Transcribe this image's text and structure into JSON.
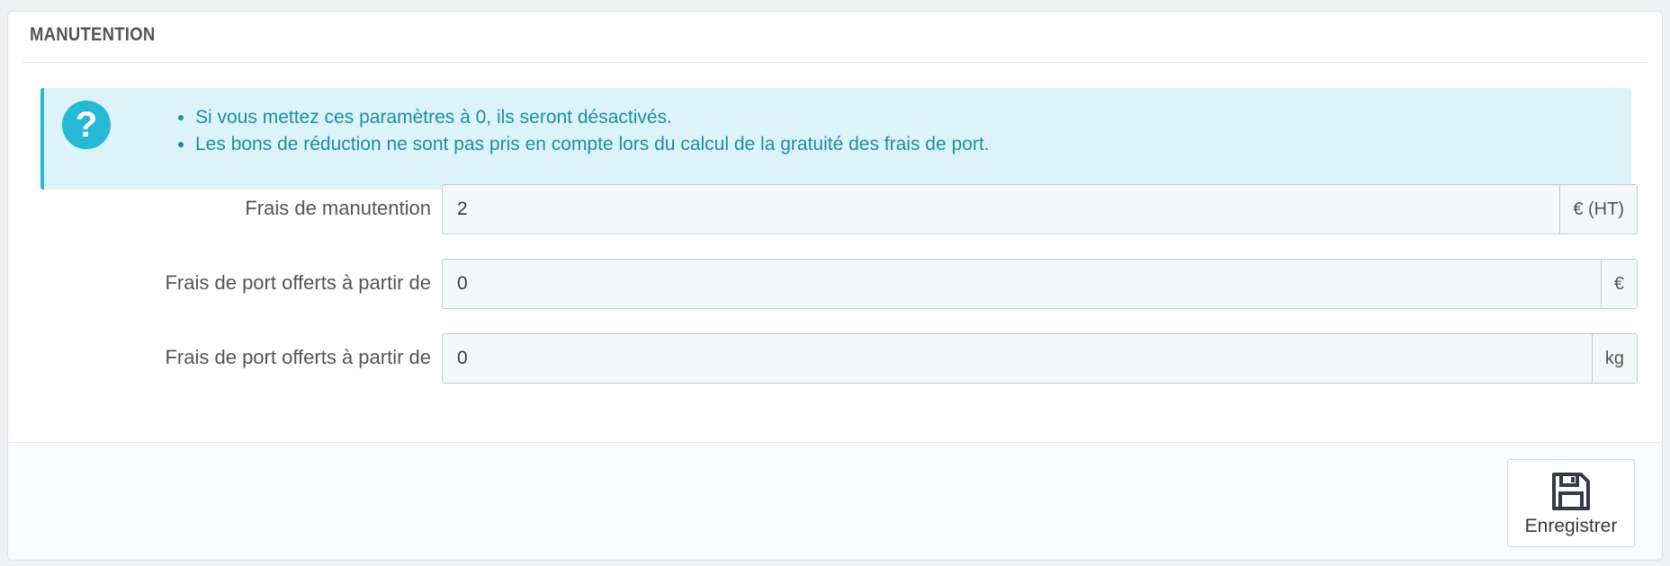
{
  "panel": {
    "title": "MANUTENTION"
  },
  "alert": {
    "icon": "question-circle-icon",
    "items": [
      "Si vous mettez ces paramètres à 0, ils seront désactivés.",
      "Les bons de réduction ne sont pas pris en compte lors du calcul de la gratuité des frais de port."
    ]
  },
  "fields": [
    {
      "label": "Frais de manutention",
      "value": "2",
      "addon": "€ (HT)"
    },
    {
      "label": "Frais de port offerts à partir de",
      "value": "0",
      "addon": "€"
    },
    {
      "label": "Frais de port offerts à partir de",
      "value": "0",
      "addon": "kg"
    }
  ],
  "footer": {
    "save_label": "Enregistrer",
    "save_icon": "floppy-disk-icon"
  },
  "colors": {
    "accent": "#25b9d7",
    "alert_bg": "#dcf4f9",
    "alert_text": "#1d8da3"
  }
}
